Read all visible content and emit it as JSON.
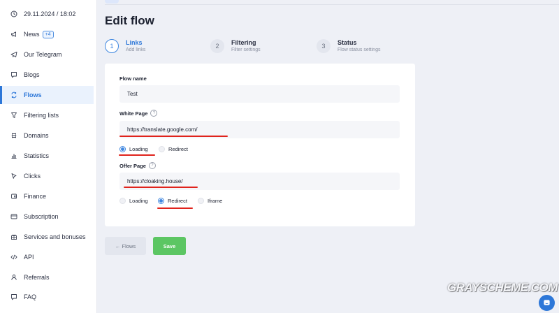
{
  "sidebar": {
    "datetime": "29.11.2024 / 18:02",
    "items": [
      {
        "label": "News",
        "badge": "+4",
        "icon": "megaphone-icon"
      },
      {
        "label": "Our Telegram",
        "icon": "telegram-icon"
      },
      {
        "label": "Blogs",
        "icon": "comment-icon"
      },
      {
        "label": "Flows",
        "icon": "flows-icon",
        "active": true
      },
      {
        "label": "Filtering lists",
        "icon": "filter-icon"
      },
      {
        "label": "Domains",
        "icon": "domain-icon"
      },
      {
        "label": "Statistics",
        "icon": "chart-icon"
      },
      {
        "label": "Clicks",
        "icon": "cursor-icon"
      },
      {
        "label": "Finance",
        "icon": "wallet-icon"
      },
      {
        "label": "Subscription",
        "icon": "card-icon"
      },
      {
        "label": "Services and bonuses",
        "icon": "gift-icon"
      },
      {
        "label": "API",
        "icon": "code-icon"
      },
      {
        "label": "Referrals",
        "icon": "users-icon"
      },
      {
        "label": "FAQ",
        "icon": "question-icon"
      }
    ]
  },
  "page": {
    "title": "Edit flow"
  },
  "steps": [
    {
      "number": "1",
      "title": "Links",
      "subtitle": "Add links",
      "active": true
    },
    {
      "number": "2",
      "title": "Filtering",
      "subtitle": "Filter settings"
    },
    {
      "number": "3",
      "title": "Status",
      "subtitle": "Flow status settings"
    }
  ],
  "form": {
    "flow_name_label": "Flow name",
    "flow_name_value": "Test",
    "white_page_label": "White Page",
    "white_page_value": "https://translate.google.com/",
    "white_page_options": [
      {
        "label": "Loading",
        "selected": true
      },
      {
        "label": "Redirect",
        "selected": false
      }
    ],
    "offer_page_label": "Offer Page",
    "offer_page_value": "https://cloaking.house/",
    "offer_page_options": [
      {
        "label": "Loading",
        "selected": false
      },
      {
        "label": "Redirect",
        "selected": true
      },
      {
        "label": "Iframe",
        "selected": false
      }
    ],
    "help_glyph": "?"
  },
  "buttons": {
    "back_label": "← Flows",
    "save_label": "Save"
  },
  "watermark": "GRAYSCHEME.COM",
  "colors": {
    "accent": "#2d77d8",
    "save": "#5cc663",
    "annotation": "#e0231c",
    "background": "#eef0f6"
  }
}
